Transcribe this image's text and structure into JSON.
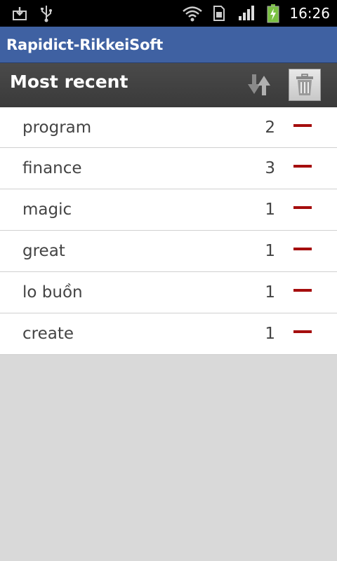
{
  "status_bar": {
    "time": "16:26",
    "icons": [
      "download-icon",
      "usb-icon",
      "wifi-icon",
      "sim-icon",
      "signal-icon",
      "battery-charging-icon"
    ]
  },
  "app": {
    "title": "Rapidict-RikkeiSoft"
  },
  "header": {
    "title": "Most recent",
    "sort_icon": "sort-icon",
    "trash_icon": "trash-icon"
  },
  "colors": {
    "title_bar": "#3f61a2",
    "header_bar": "#424242",
    "remove_accent": "#a50d0d",
    "battery": "#7ac142"
  },
  "history": [
    {
      "word": "program",
      "count": "2"
    },
    {
      "word": "finance",
      "count": "3"
    },
    {
      "word": "magic",
      "count": "1"
    },
    {
      "word": "great",
      "count": "1"
    },
    {
      "word": "lo buồn",
      "count": "1"
    },
    {
      "word": "create",
      "count": "1"
    }
  ]
}
